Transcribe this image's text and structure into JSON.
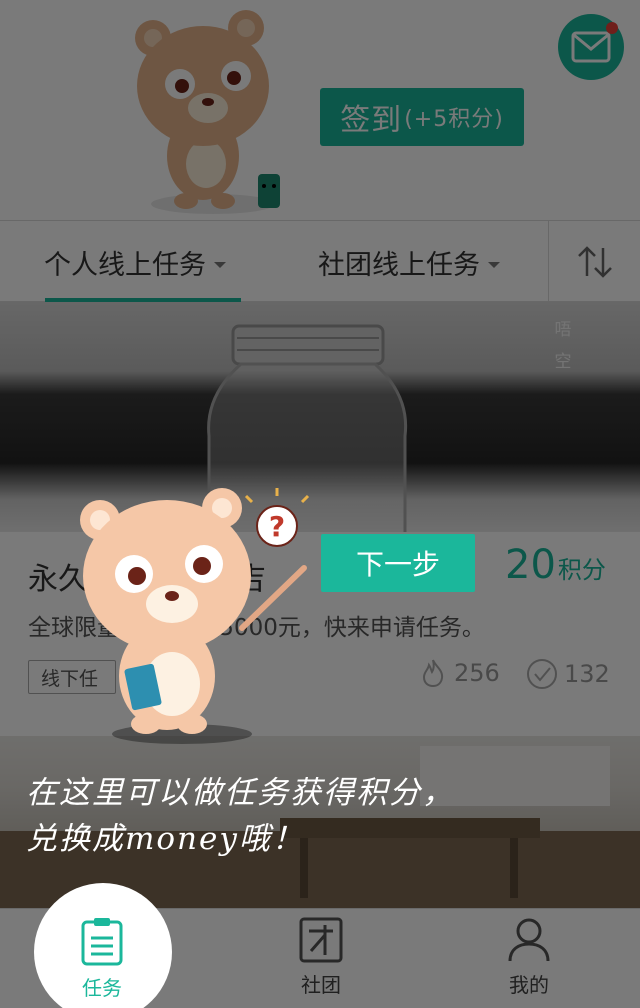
{
  "header": {
    "checkin_label": "签到",
    "checkin_points": "(+5积分)"
  },
  "tabs": {
    "personal": "个人线上任务",
    "club": "社团线上任务"
  },
  "banner": {
    "vertical_text": [
      "唔",
      "空"
    ]
  },
  "task": {
    "title_left": "永久",
    "title_right": "吉",
    "points_value": "20",
    "points_unit": "积分",
    "description": "全球限量，                        等价值5000元，快来申请任务。",
    "tag": "线下任",
    "hot_count": "256",
    "done_count": "132"
  },
  "guide": {
    "next_label": "下一步",
    "hint_line1": "在这里可以做任务获得积分，",
    "hint_line2": "兑换成money哦！"
  },
  "bottom_nav": {
    "tasks": "任务",
    "club": "社团",
    "mine": "我的"
  },
  "colors": {
    "accent": "#1bb79b",
    "notify_dot": "#e8413a"
  }
}
